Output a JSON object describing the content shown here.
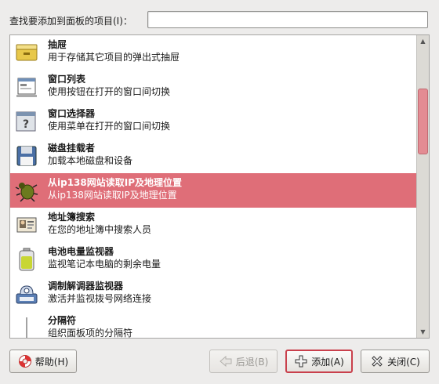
{
  "search": {
    "label": "查找要添加到面板的项目(I)：",
    "value": ""
  },
  "items": [
    {
      "icon": "drawer-icon",
      "title": "抽屉",
      "desc": "用于存储其它项目的弹出式抽屉",
      "selected": false
    },
    {
      "icon": "window-list-icon",
      "title": "窗口列表",
      "desc": "使用按钮在打开的窗口间切换",
      "selected": false
    },
    {
      "icon": "window-selector-icon",
      "title": "窗口选择器",
      "desc": "使用菜单在打开的窗口间切换",
      "selected": false
    },
    {
      "icon": "disk-mounter-icon",
      "title": "磁盘挂载者",
      "desc": "加载本地磁盘和设备",
      "selected": false
    },
    {
      "icon": "bug-icon",
      "title": "从ip138网站读取IP及地理位置",
      "desc": "从ip138网站读取IP及地理位置",
      "selected": true
    },
    {
      "icon": "address-book-icon",
      "title": "地址簿搜索",
      "desc": "在您的地址簿中搜索人员",
      "selected": false
    },
    {
      "icon": "battery-icon",
      "title": "电池电量监视器",
      "desc": "监视笔记本电脑的剩余电量",
      "selected": false
    },
    {
      "icon": "modem-icon",
      "title": "调制解调器监视器",
      "desc": "激活并监视拨号网络连接",
      "selected": false
    },
    {
      "icon": "separator-icon",
      "title": "分隔符",
      "desc": "组织面板项的分隔符",
      "selected": false
    }
  ],
  "buttons": {
    "help": "帮助(H)",
    "back": "后退(B)",
    "add": "添加(A)",
    "close": "关闭(C)"
  },
  "colors": {
    "selection": "#df6e78",
    "focus": "#c9404c"
  }
}
